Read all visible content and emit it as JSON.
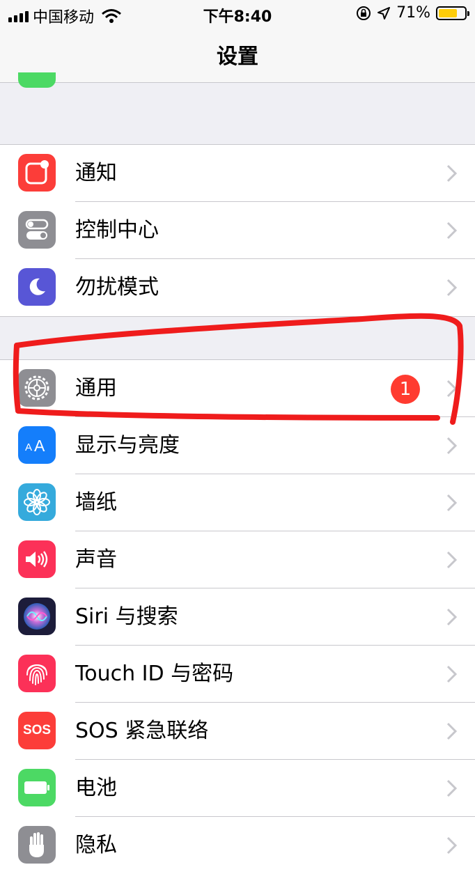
{
  "status_bar": {
    "carrier": "中国移动",
    "time": "下午8:40",
    "battery_percent": "71%",
    "battery_level": 0.71,
    "battery_color": "#fecd0a"
  },
  "nav": {
    "title": "设置"
  },
  "settings_groups": [
    {
      "items": [
        {
          "label": "通知",
          "icon": "notifications-icon",
          "color": "#fc3d39"
        },
        {
          "label": "控制中心",
          "icon": "control-center-icon",
          "color": "#8e8e93"
        },
        {
          "label": "勿扰模式",
          "icon": "moon-icon",
          "color": "#5856d6"
        }
      ]
    },
    {
      "items": [
        {
          "label": "通用",
          "icon": "gear-icon",
          "color": "#8e8e93",
          "badge": "1"
        },
        {
          "label": "显示与亮度",
          "icon": "display-brightness-icon",
          "color": "#147efb"
        },
        {
          "label": "墙纸",
          "icon": "wallpaper-flower-icon",
          "color": "#35aadc"
        },
        {
          "label": "声音",
          "icon": "speaker-icon",
          "color": "#fc3158"
        },
        {
          "label": "Siri 与搜索",
          "icon": "siri-icon",
          "color": "#1c1c3a"
        },
        {
          "label": "Touch ID 与密码",
          "icon": "fingerprint-icon",
          "color": "#fc3158"
        },
        {
          "label": "SOS 紧急联络",
          "icon": "sos-icon",
          "color": "#fc3d39",
          "icon_text": "SOS"
        },
        {
          "label": "电池",
          "icon": "battery-icon",
          "color": "#4cd964"
        },
        {
          "label": "隐私",
          "icon": "privacy-hand-icon",
          "color": "#8e8e93"
        }
      ]
    }
  ]
}
